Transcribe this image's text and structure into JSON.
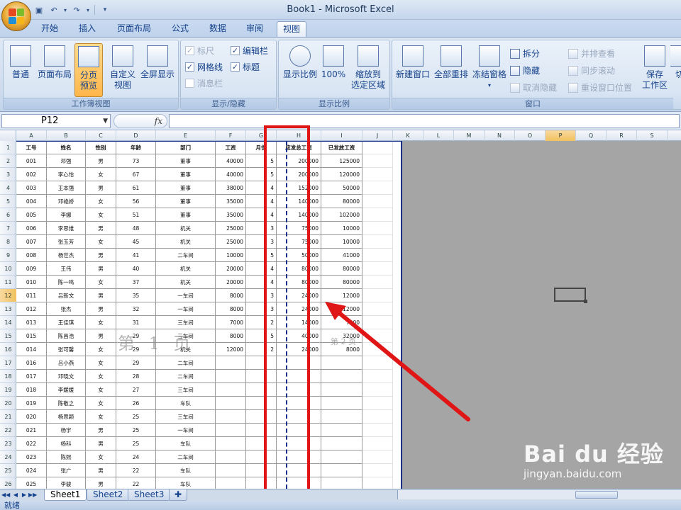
{
  "window_title": "Book1 - Microsoft Excel",
  "tabs": [
    "开始",
    "插入",
    "页面布局",
    "公式",
    "数据",
    "审阅",
    "视图"
  ],
  "active_tab": "视图",
  "ribbon": {
    "workbook_views": {
      "label": "工作簿视图",
      "normal": "普通",
      "page_layout": "页面布局",
      "page_break_line1": "分页",
      "page_break_line2": "预览",
      "custom_line1": "自定义",
      "custom_line2": "视图",
      "full_screen": "全屏显示"
    },
    "show_hide": {
      "label": "显示/隐藏",
      "ruler": "标尺",
      "formula_bar": "编辑栏",
      "gridlines": "网格线",
      "headings": "标题",
      "message_bar": "消息栏"
    },
    "zoom": {
      "label": "显示比例",
      "zoom": "显示比例",
      "hundred": "100%",
      "zoom_selection_line1": "缩放到",
      "zoom_selection_line2": "选定区域"
    },
    "window": {
      "label": "窗口",
      "new_window": "新建窗口",
      "arrange_all": "全部重排",
      "freeze_panes": "冻结窗格",
      "split": "拆分",
      "hide": "隐藏",
      "unhide": "取消隐藏",
      "side_by_side": "并排查看",
      "sync_scroll": "同步滚动",
      "reset_position": "重设窗口位置",
      "save_workspace_line1": "保存",
      "save_workspace_line2": "工作区",
      "switch_partial": "切"
    }
  },
  "namebox": "P12",
  "fx_label": "fx",
  "columns": [
    "A",
    "B",
    "C",
    "D",
    "E",
    "F",
    "G",
    "H",
    "I",
    "J",
    "K",
    "L",
    "M",
    "N",
    "O",
    "P",
    "Q",
    "R",
    "S"
  ],
  "selected_column": "P",
  "selected_row": 12,
  "row_numbers": [
    1,
    2,
    3,
    4,
    5,
    6,
    7,
    8,
    9,
    10,
    11,
    12,
    13,
    14,
    15,
    16,
    17,
    18,
    19,
    20,
    21,
    22,
    23,
    24,
    25,
    26
  ],
  "table": {
    "headers": [
      "工号",
      "姓名",
      "性别",
      "年龄",
      "部门",
      "工资",
      "月份",
      "应发总工资",
      "已发放工资"
    ],
    "header_visible_display": [
      "工号",
      "姓名",
      "性别",
      "年龄",
      "部门",
      "工资",
      "月份",
      "应发总工资",
      "已发放工资"
    ],
    "rows": [
      [
        "001",
        "邓强",
        "男",
        "73",
        "董事",
        "40000",
        "5",
        "200000",
        "125000"
      ],
      [
        "002",
        "李心怡",
        "女",
        "67",
        "董事",
        "40000",
        "5",
        "200000",
        "120000"
      ],
      [
        "003",
        "王本强",
        "男",
        "61",
        "董事",
        "38000",
        "4",
        "152000",
        "50000"
      ],
      [
        "004",
        "邓艳娇",
        "女",
        "56",
        "董事",
        "35000",
        "4",
        "140000",
        "80000"
      ],
      [
        "005",
        "李娜",
        "女",
        "51",
        "董事",
        "35000",
        "4",
        "140000",
        "102000"
      ],
      [
        "006",
        "李思维",
        "男",
        "48",
        "机关",
        "25000",
        "3",
        "75000",
        "10000"
      ],
      [
        "007",
        "张玉芳",
        "女",
        "45",
        "机关",
        "25000",
        "3",
        "75000",
        "10000"
      ],
      [
        "008",
        "杨世杰",
        "男",
        "41",
        "二车间",
        "10000",
        "5",
        "50000",
        "41000"
      ],
      [
        "009",
        "王伟",
        "男",
        "40",
        "机关",
        "20000",
        "4",
        "80000",
        "80000"
      ],
      [
        "010",
        "陈一鸣",
        "女",
        "37",
        "机关",
        "20000",
        "4",
        "80000",
        "80000"
      ],
      [
        "011",
        "吕新文",
        "男",
        "35",
        "一车间",
        "8000",
        "3",
        "24000",
        "12000"
      ],
      [
        "012",
        "张杰",
        "男",
        "32",
        "一车间",
        "8000",
        "3",
        "24000",
        "12000"
      ],
      [
        "013",
        "王佳琪",
        "女",
        "31",
        "三车间",
        "7000",
        "2",
        "14000",
        "7000"
      ],
      [
        "015",
        "陈昌浩",
        "男",
        "29",
        "三车间",
        "8000",
        "5",
        "40000",
        "32000"
      ],
      [
        "014",
        "张可馨",
        "女",
        "29",
        "机关",
        "12000",
        "2",
        "24000",
        "8000"
      ],
      [
        "016",
        "吕小燕",
        "女",
        "29",
        "二车间",
        "",
        "",
        "",
        ""
      ],
      [
        "017",
        "邓晓文",
        "女",
        "28",
        "二车间",
        "",
        "",
        "",
        ""
      ],
      [
        "018",
        "李媛媛",
        "女",
        "27",
        "三车间",
        "",
        "",
        "",
        ""
      ],
      [
        "019",
        "陈敬之",
        "女",
        "26",
        "车队",
        "",
        "",
        "",
        ""
      ],
      [
        "020",
        "杨思颖",
        "女",
        "25",
        "三车间",
        "",
        "",
        "",
        ""
      ],
      [
        "021",
        "杨宇",
        "男",
        "25",
        "一车间",
        "",
        "",
        "",
        ""
      ],
      [
        "022",
        "杨科",
        "男",
        "25",
        "车队",
        "",
        "",
        "",
        ""
      ],
      [
        "023",
        "陈熙",
        "女",
        "24",
        "二车间",
        "",
        "",
        "",
        ""
      ],
      [
        "024",
        "张广",
        "男",
        "22",
        "车队",
        "",
        "",
        "",
        ""
      ],
      [
        "025",
        "李骏",
        "男",
        "22",
        "车队",
        "",
        "",
        "",
        ""
      ]
    ]
  },
  "page1_label": "第 1 页",
  "page2_label": "第 2 页",
  "sheets": [
    "Sheet1",
    "Sheet2",
    "Sheet3"
  ],
  "active_sheet": "Sheet1",
  "status": "就绪",
  "watermark": {
    "brand": "Bai du 经验",
    "url": "jingyan.baidu.com"
  },
  "colors": {
    "highlight": "#e01515",
    "page_break": "#1a2e8a",
    "ribbon_pressed": "#ffb64a"
  }
}
